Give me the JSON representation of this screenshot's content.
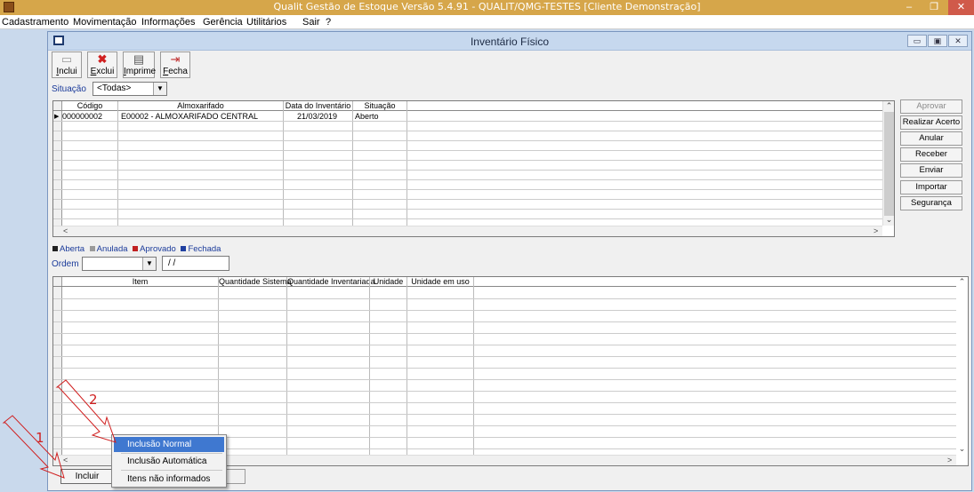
{
  "app": {
    "title": "Qualit Gestão de Estoque Versão 5.4.91 - QUALIT/QMG-TESTES [Cliente Demonstração]",
    "min": "–",
    "max": "❐",
    "close": "✕"
  },
  "menu": [
    "Cadastramento",
    "Movimentação",
    "Informações",
    "Gerência",
    "Utilitários",
    "Sair",
    "?"
  ],
  "window": {
    "title": "Inventário Físico",
    "min": "▭",
    "max": "▣",
    "close": "✕"
  },
  "toolbar": {
    "inclui": "Inclui",
    "exclui": "Exclui",
    "imprime": "Imprime",
    "fecha": "Fecha"
  },
  "filter": {
    "situacao_label": "Situação",
    "situacao_value": "<Todas>"
  },
  "inventory_grid": {
    "headers": [
      "Código",
      "Almoxarifado",
      "Data do Inventário",
      "Situação"
    ],
    "rows": [
      {
        "codigo": "000000002",
        "almoxarifado": "E00002 - ALMOXARIFADO CENTRAL",
        "data": "21/03/2019",
        "situacao": "Aberto"
      }
    ]
  },
  "actions": {
    "aprovar": "Aprovar",
    "realizar_acerto": "Realizar Acerto",
    "anular": "Anular",
    "receber": "Receber",
    "enviar": "Enviar",
    "importar": "Importar",
    "seguranca": "Segurança"
  },
  "legend": [
    {
      "label": "Aberta",
      "color": "#202020"
    },
    {
      "label": "Anulada",
      "color": "#9a9a9a"
    },
    {
      "label": "Aprovado",
      "color": "#c02020"
    },
    {
      "label": "Fechada",
      "color": "#2040a0"
    }
  ],
  "ordem": {
    "label": "Ordem",
    "date_value": "/ /"
  },
  "items_grid": {
    "headers": [
      "Item",
      "Quantidade Sistema",
      "Quantidade Inventariada",
      "Unidade",
      "Unidade em uso"
    ]
  },
  "bottom": {
    "incluir": "Incluir"
  },
  "context_menu": {
    "items": [
      "Inclusão Normal",
      "Inclusão Automática",
      "Itens não informados"
    ]
  },
  "annotations": {
    "one": "1",
    "two": "2",
    "color": "#d02020"
  },
  "icons": {
    "scroll_up": "⌃",
    "scroll_down": "⌄",
    "scroll_left": "<",
    "scroll_right": ">",
    "dropdown": "▼",
    "row_pointer": "▶"
  }
}
